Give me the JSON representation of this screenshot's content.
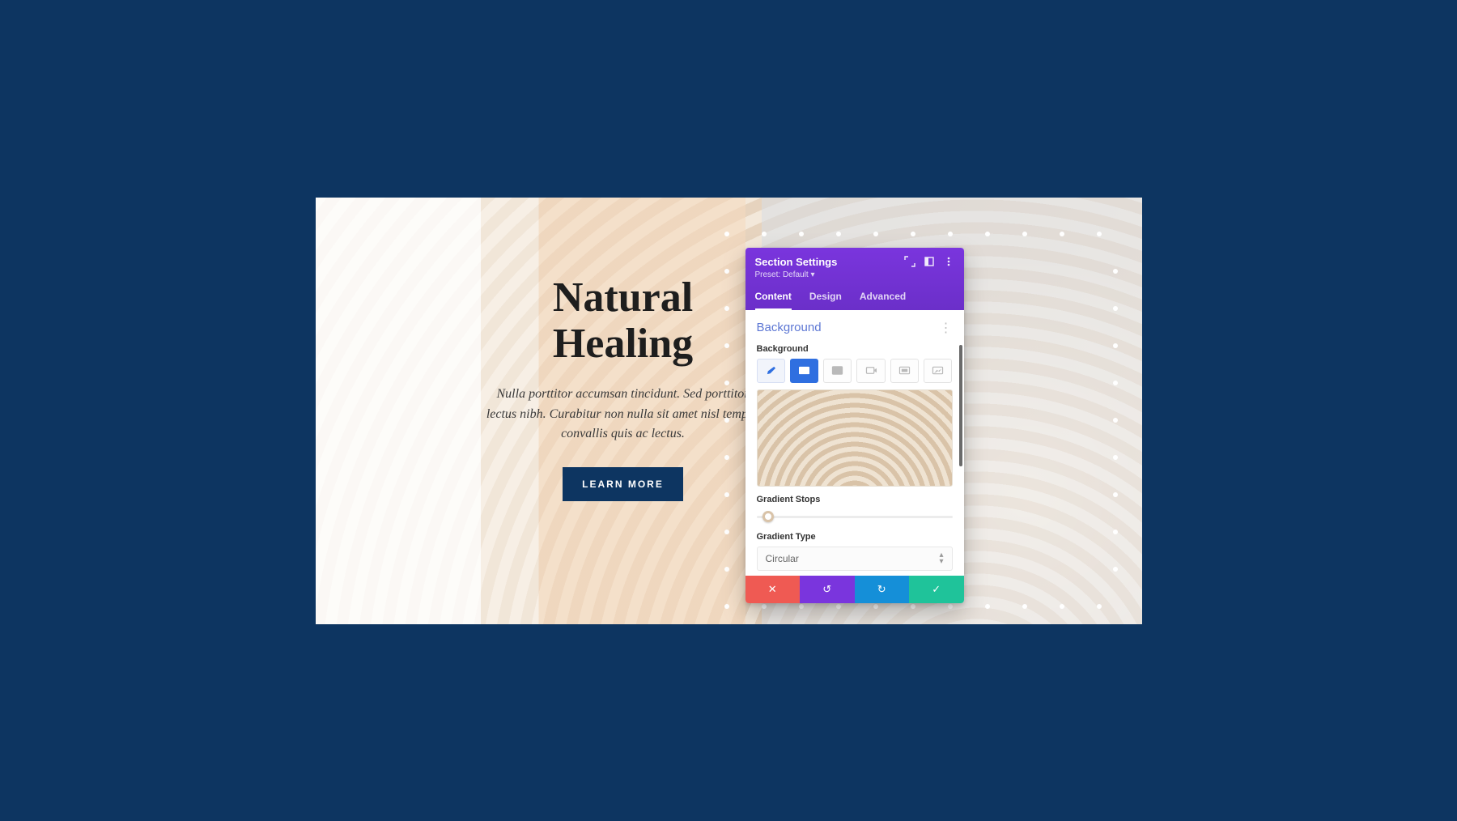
{
  "colors": {
    "page_bg": "#0d3561",
    "panel_purple": "#6b2fc9",
    "accent_blue": "#2f6fe0",
    "btn_cancel": "#ef5a53",
    "btn_undo": "#7a35dd",
    "btn_redo": "#158fd8",
    "btn_save": "#1fc39a"
  },
  "hero": {
    "title_line1": "Natural",
    "title_line2": "Healing",
    "body": "Nulla porttitor accumsan tincidunt. Sed porttitor lectus nibh. Curabitur non nulla sit amet nisl tempus convallis quis ac lectus.",
    "cta_label": "LEARN MORE"
  },
  "panel": {
    "title": "Section Settings",
    "preset_label": "Preset: Default",
    "tabs": {
      "content": "Content",
      "design": "Design",
      "advanced": "Advanced"
    },
    "active_tab": "Content",
    "section_heading": "Background",
    "field_bg_label": "Background",
    "bg_type_tabs": [
      {
        "id": "color",
        "name": "color-tab"
      },
      {
        "id": "gradient",
        "name": "gradient-tab",
        "active": true
      },
      {
        "id": "image",
        "name": "image-tab"
      },
      {
        "id": "video",
        "name": "video-tab"
      },
      {
        "id": "pattern",
        "name": "pattern-tab"
      },
      {
        "id": "mask",
        "name": "mask-tab"
      }
    ],
    "gradient_stops_label": "Gradient Stops",
    "gradient_stop_position_percent": 6,
    "gradient_type_label": "Gradient Type",
    "gradient_type_value": "Circular",
    "footer": {
      "cancel": "✕",
      "undo": "↺",
      "redo": "↻",
      "save": "✓"
    }
  }
}
